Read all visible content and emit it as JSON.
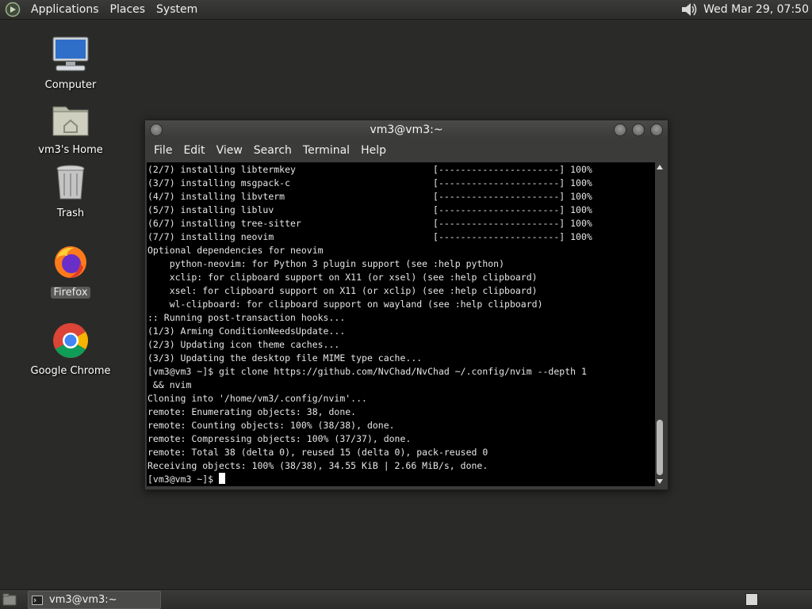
{
  "top_panel": {
    "menus": [
      "Applications",
      "Places",
      "System"
    ],
    "clock": "Wed Mar 29, 07:50"
  },
  "desktop_icons": [
    {
      "label": "Computer",
      "icon": "computer-icon"
    },
    {
      "label": "vm3's Home",
      "icon": "home-folder-icon"
    },
    {
      "label": "Trash",
      "icon": "trash-icon"
    },
    {
      "label": "Firefox",
      "icon": "firefox-icon"
    },
    {
      "label": "Google Chrome",
      "icon": "chrome-icon"
    }
  ],
  "terminal": {
    "title": "vm3@vm3:~",
    "menu": [
      "File",
      "Edit",
      "View",
      "Search",
      "Terminal",
      "Help"
    ],
    "lines": [
      "(2/7) installing libtermkey                         [----------------------] 100%",
      "(3/7) installing msgpack-c                          [----------------------] 100%",
      "(4/7) installing libvterm                           [----------------------] 100%",
      "(5/7) installing libluv                             [----------------------] 100%",
      "(6/7) installing tree-sitter                        [----------------------] 100%",
      "(7/7) installing neovim                             [----------------------] 100%",
      "Optional dependencies for neovim",
      "    python-neovim: for Python 3 plugin support (see :help python)",
      "    xclip: for clipboard support on X11 (or xsel) (see :help clipboard)",
      "    xsel: for clipboard support on X11 (or xclip) (see :help clipboard)",
      "    wl-clipboard: for clipboard support on wayland (see :help clipboard)",
      ":: Running post-transaction hooks...",
      "(1/3) Arming ConditionNeedsUpdate...",
      "(2/3) Updating icon theme caches...",
      "(3/3) Updating the desktop file MIME type cache...",
      "[vm3@vm3 ~]$ git clone https://github.com/NvChad/NvChad ~/.config/nvim --depth 1",
      " && nvim",
      "Cloning into '/home/vm3/.config/nvim'...",
      "remote: Enumerating objects: 38, done.",
      "remote: Counting objects: 100% (38/38), done.",
      "remote: Compressing objects: 100% (37/37), done.",
      "remote: Total 38 (delta 0), reused 15 (delta 0), pack-reused 0",
      "Receiving objects: 100% (38/38), 34.55 KiB | 2.66 MiB/s, done."
    ],
    "prompt": "[vm3@vm3 ~]$ "
  },
  "taskbar": {
    "window_label": "vm3@vm3:~"
  }
}
